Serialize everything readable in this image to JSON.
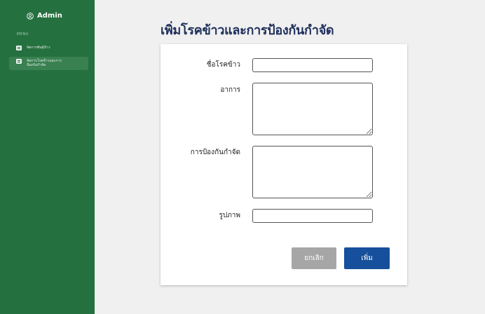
{
  "sidebar": {
    "brand": {
      "icon": "user-circle-icon",
      "label": "Admin"
    },
    "menu_heading": "MENU",
    "items": [
      {
        "icon": "document-icon",
        "label": "จัดการพันธุ์ข้าว"
      },
      {
        "icon": "document-icon",
        "label": "จัดการโรคข้าวและการป้องกันกำจัด",
        "active": true
      }
    ]
  },
  "main": {
    "title": "เพิ่มโรคข้าวและการป้องกันกำจัด",
    "form": {
      "name_label": "ชื่อโรคข้าว",
      "name_value": "",
      "symptom_label": "อาการ",
      "symptom_value": "",
      "prevention_label": "การป้องกันกำจัด",
      "prevention_value": "",
      "image_label": "รูปภาพ",
      "image_value": "",
      "cancel_label": "ยกเลิก",
      "add_label": "เพิ่ม"
    }
  },
  "colors": {
    "sidebar_bg": "#25703f",
    "active_item_bg": "#3a8152",
    "title": "#1e2f5a",
    "cancel_button": "#a6a6a6",
    "add_button": "#164f9c",
    "page_bg": "#f0f0f0"
  }
}
